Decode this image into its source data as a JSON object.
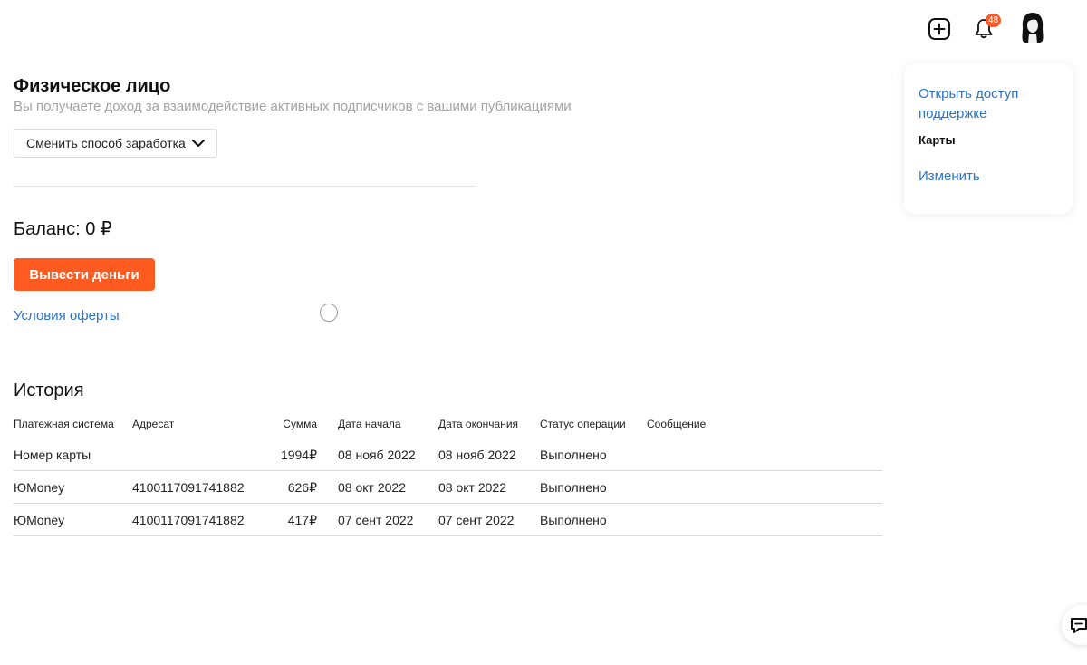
{
  "header": {
    "add_icon": "plus-square-icon",
    "bell_icon": "bell-icon",
    "notification_count": "48",
    "avatar": "user-avatar"
  },
  "earning": {
    "title": "Физическое лицо",
    "subtitle": "Вы получаете доход за взаимодействие активных подписчиков с вашими публикациями",
    "change_mode_label": "Сменить способ заработка"
  },
  "balance": {
    "label": "Баланс: 0 ₽",
    "withdraw_label": "Вывести деньги",
    "offer_link": "Условия оферты"
  },
  "history": {
    "title": "История",
    "columns": [
      "Платежная система",
      "Адресат",
      "Сумма",
      "Дата начала",
      "Дата окончания",
      "Статус операции",
      "Сообщение"
    ],
    "rows": [
      {
        "system": "Номер карты",
        "recipient": "",
        "amount": "1994₽",
        "start": "08 нояб 2022",
        "end": "08 нояб 2022",
        "status": "Выполнено",
        "message": ""
      },
      {
        "system": "ЮMoney",
        "recipient": "4100117091741882",
        "amount": "626₽",
        "start": "08 окт 2022",
        "end": "08 окт 2022",
        "status": "Выполнено",
        "message": ""
      },
      {
        "system": "ЮMoney",
        "recipient": "4100117091741882",
        "amount": "417₽",
        "start": "07 сент 2022",
        "end": "07 сент 2022",
        "status": "Выполнено",
        "message": ""
      }
    ]
  },
  "sidebar": {
    "support_link": "Открыть доступ поддержке",
    "cards_label": "Карты",
    "edit_link": "Изменить"
  },
  "colors": {
    "accent": "#ff5a1f",
    "link": "#2a73c9",
    "badge": "#ff5722"
  },
  "chat_icon": "chat-bubble-icon"
}
